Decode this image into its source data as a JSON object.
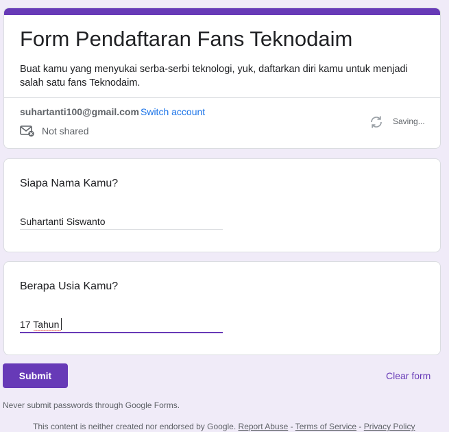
{
  "form": {
    "title": "Form Pendaftaran Fans Teknodaim",
    "description": "Buat kamu yang menyukai serba-serbi teknologi, yuk, daftarkan diri kamu untuk menjadi salah satu fans Teknodaim.",
    "accent_color": "#673ab7"
  },
  "account": {
    "email": "suhartanti100@gmail.com",
    "switch_label": "Switch account",
    "shared_status": "Not shared",
    "save_status": "Saving...",
    "icons": {
      "mail": "mail-off-icon",
      "sync": "sync-icon"
    }
  },
  "questions": [
    {
      "label": "Siapa Nama Kamu?",
      "value": "Suhartanti Siswanto"
    },
    {
      "label": "Berapa Usia Kamu?",
      "value": "17 Tahun"
    }
  ],
  "actions": {
    "submit_label": "Submit",
    "clear_label": "Clear form"
  },
  "notice": "Never submit passwords through Google Forms.",
  "footer": {
    "text": "This content is neither created nor endorsed by Google.",
    "report_abuse": "Report Abuse",
    "sep": "-",
    "terms": "Terms of Service",
    "privacy": "Privacy Policy"
  }
}
